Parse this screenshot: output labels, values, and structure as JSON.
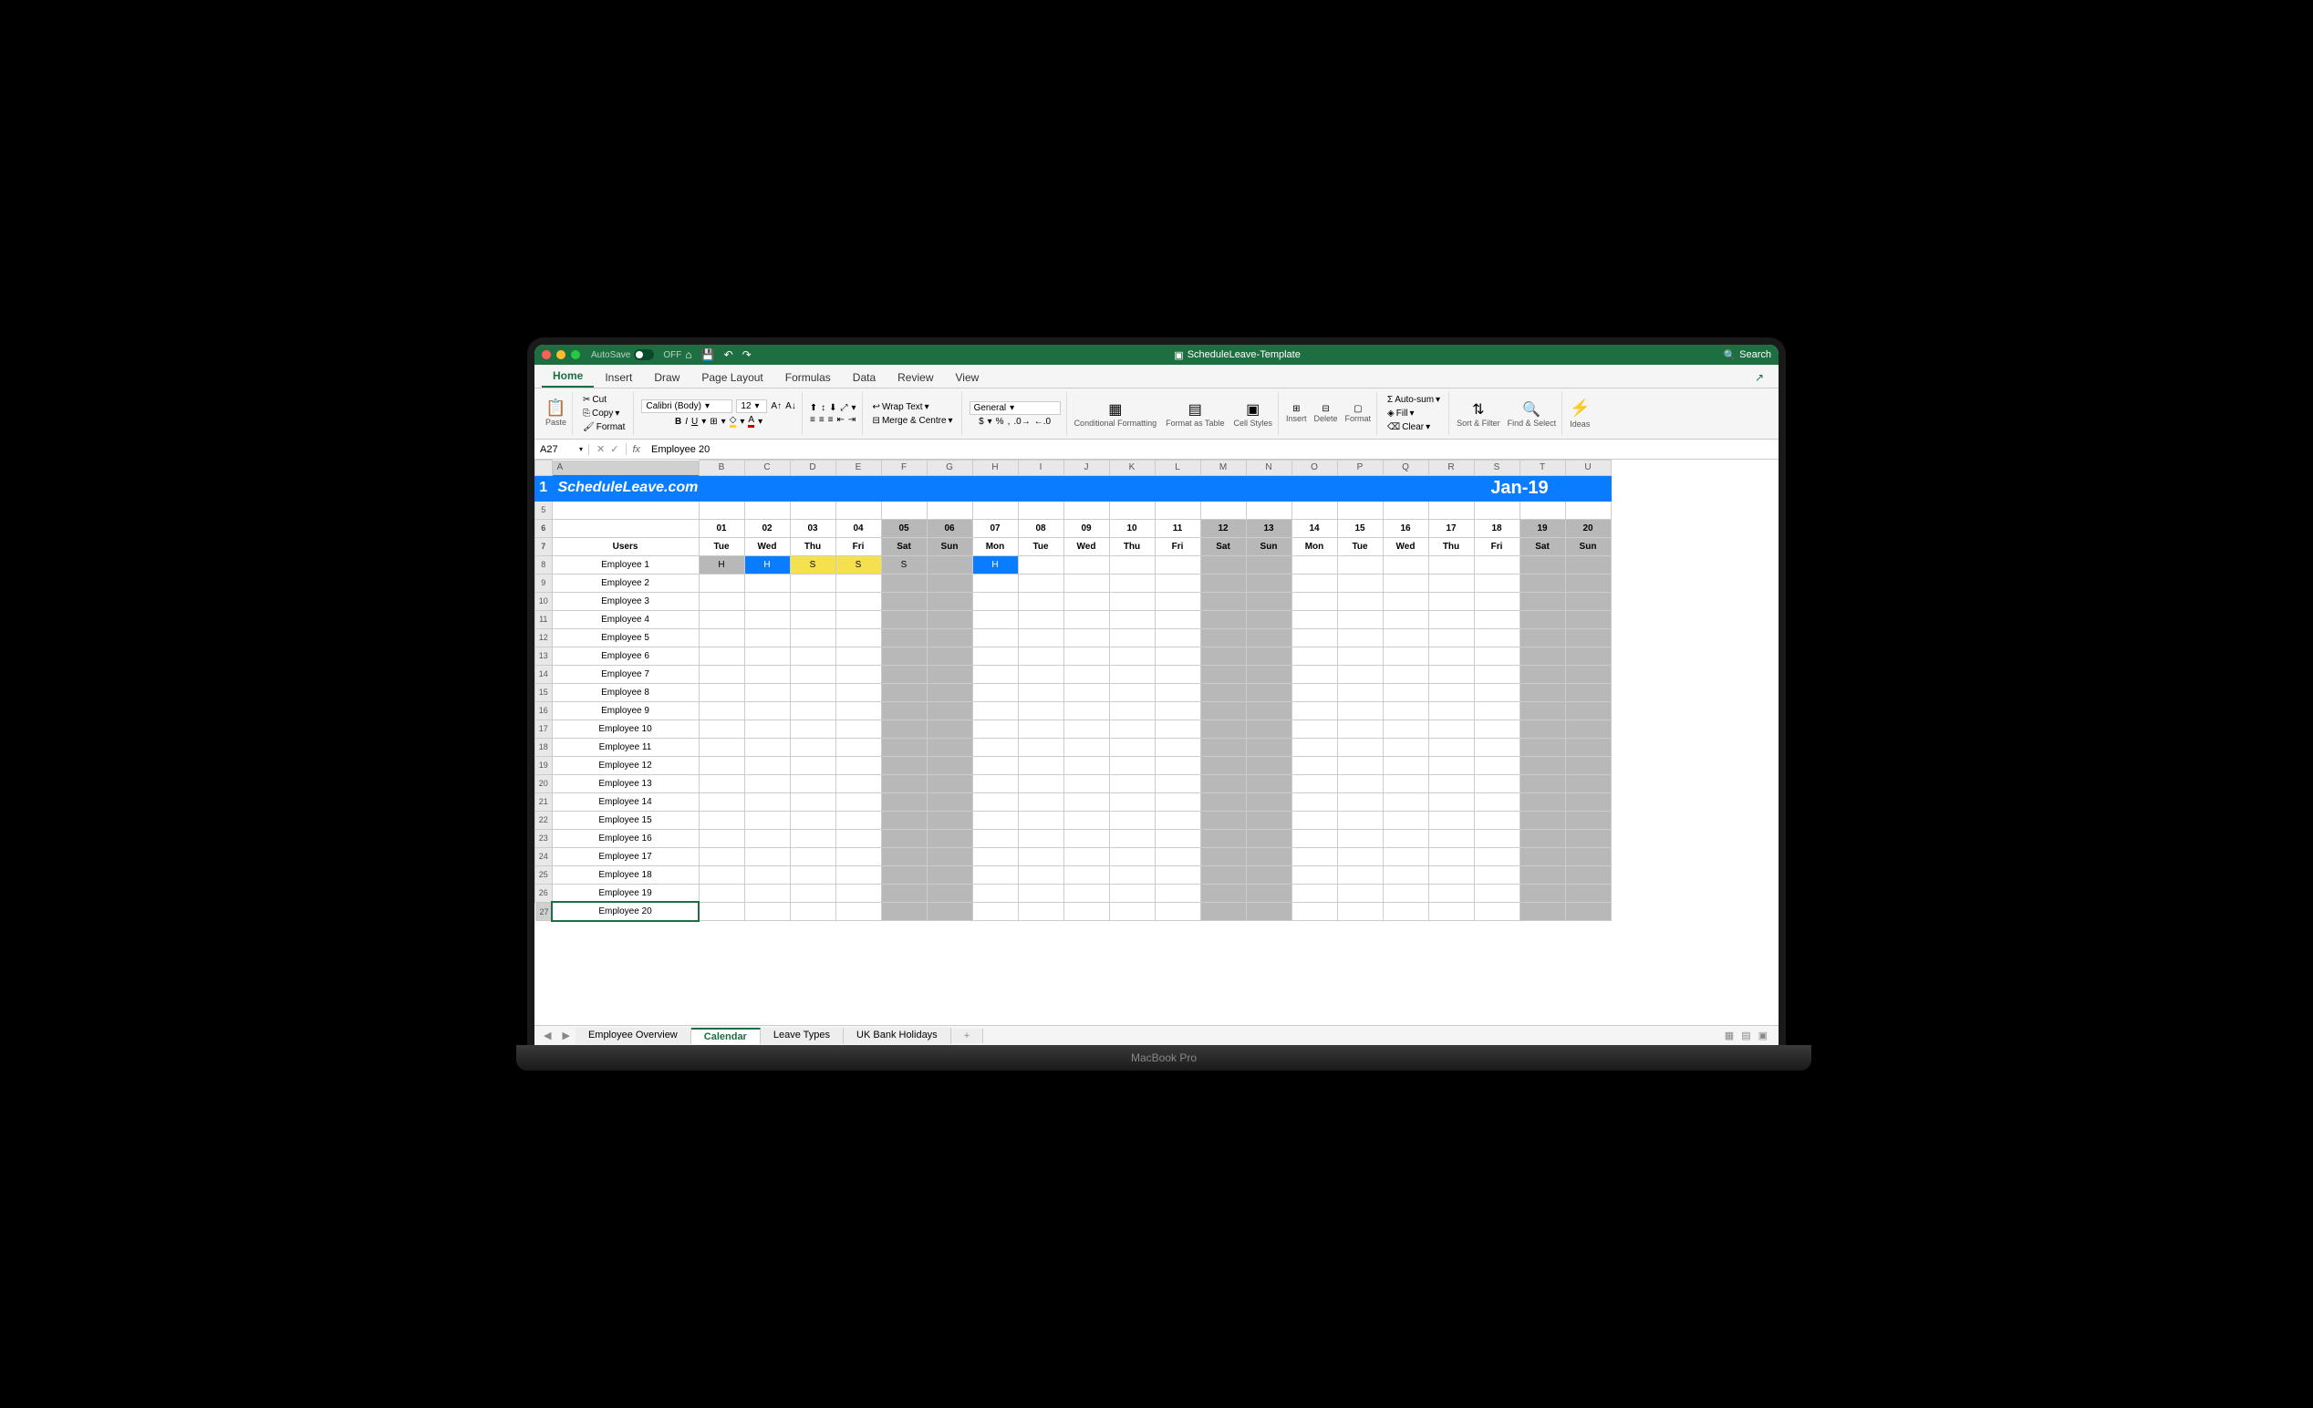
{
  "title": "ScheduleLeave-Template",
  "autosave": "AutoSave",
  "autosave_state": "OFF",
  "search": "Search",
  "laptop": "MacBook Pro",
  "tabs": [
    "Home",
    "Insert",
    "Draw",
    "Page Layout",
    "Formulas",
    "Data",
    "Review",
    "View"
  ],
  "active_tab": "Home",
  "ribbon": {
    "paste": "Paste",
    "cut": "Cut",
    "copy": "Copy",
    "format_p": "Format",
    "font": "Calibri (Body)",
    "size": "12",
    "wrap": "Wrap Text",
    "merge": "Merge & Centre",
    "numfmt": "General",
    "cond": "Conditional Formatting",
    "fat": "Format as Table",
    "cstyle": "Cell Styles",
    "insert": "Insert",
    "delete": "Delete",
    "format": "Format",
    "autosum": "Auto-sum",
    "fill": "Fill",
    "clear": "Clear",
    "sort": "Sort & Filter",
    "find": "Find & Select",
    "ideas": "Ideas"
  },
  "namebox": "A27",
  "formula": "Employee 20",
  "brand": "ScheduleLeave.com",
  "month": "Jan-19",
  "users_hdr": "Users",
  "cols": [
    "",
    "A",
    "B",
    "C",
    "D",
    "E",
    "F",
    "G",
    "H",
    "I",
    "J",
    "K",
    "L",
    "M",
    "N",
    "O",
    "P",
    "Q",
    "R",
    "S",
    "T",
    "U"
  ],
  "days": {
    "nums": [
      "01",
      "02",
      "03",
      "04",
      "05",
      "06",
      "07",
      "08",
      "09",
      "10",
      "11",
      "12",
      "13",
      "14",
      "15",
      "16",
      "17",
      "18",
      "19",
      "20"
    ],
    "dows": [
      "Tue",
      "Wed",
      "Thu",
      "Fri",
      "Sat",
      "Sun",
      "Mon",
      "Tue",
      "Wed",
      "Thu",
      "Fri",
      "Sat",
      "Sun",
      "Mon",
      "Tue",
      "Wed",
      "Thu",
      "Fri",
      "Sat",
      "Sun"
    ],
    "weekend": [
      false,
      false,
      false,
      false,
      true,
      true,
      false,
      false,
      false,
      false,
      false,
      true,
      true,
      false,
      false,
      false,
      false,
      false,
      true,
      true
    ]
  },
  "employees": [
    "Employee 1",
    "Employee 2",
    "Employee 3",
    "Employee 4",
    "Employee 5",
    "Employee 6",
    "Employee 7",
    "Employee 8",
    "Employee 9",
    "Employee 10",
    "Employee 11",
    "Employee 12",
    "Employee 13",
    "Employee 14",
    "Employee 15",
    "Employee 16",
    "Employee 17",
    "Employee 18",
    "Employee 19",
    "Employee 20"
  ],
  "marks": {
    "0": {
      "0": {
        "t": "H",
        "c": "wknd"
      },
      "1": {
        "t": "H",
        "c": "hol"
      },
      "2": {
        "t": "S",
        "c": "sick"
      },
      "3": {
        "t": "S",
        "c": "sick"
      },
      "4": {
        "t": "S",
        "c": "wknd"
      },
      "6": {
        "t": "H",
        "c": "hol"
      }
    }
  },
  "sheet_tabs": [
    "Employee Overview",
    "Calendar",
    "Leave Types",
    "UK Bank Holidays"
  ],
  "active_sheet": "Calendar"
}
